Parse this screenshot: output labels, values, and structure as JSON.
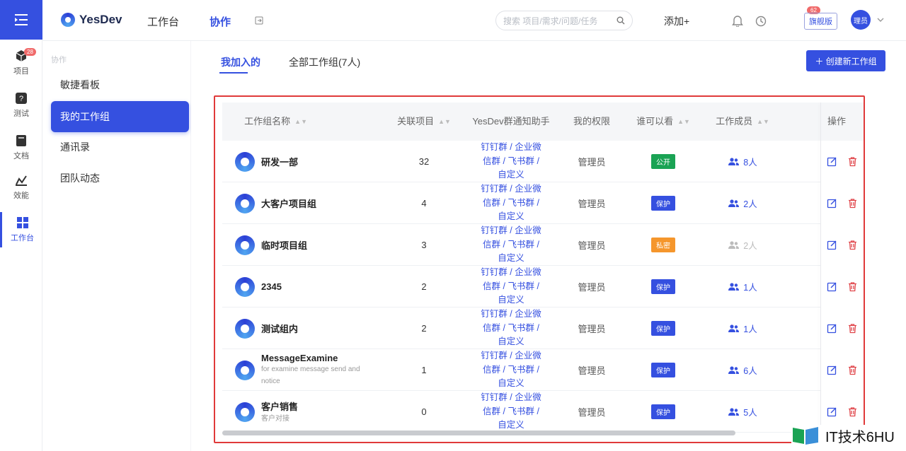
{
  "rail": {
    "items": [
      {
        "label": "项目",
        "badge": "28"
      },
      {
        "label": "测试"
      },
      {
        "label": "文档"
      },
      {
        "label": "效能"
      },
      {
        "label": "工作台"
      }
    ]
  },
  "header": {
    "logo": "YesDev",
    "nav": [
      "工作台",
      "协作"
    ],
    "search_placeholder": "搜索 项目/需求/问题/任务",
    "add_label": "添加+",
    "alarm_badge": "62",
    "edition": "旗舰版",
    "avatar": "理员"
  },
  "sidebar": {
    "section": "协作",
    "items": [
      "敏捷看板",
      "我的工作组",
      "通讯录",
      "团队动态"
    ]
  },
  "tabs": [
    "我加入的",
    "全部工作组(7人)"
  ],
  "create_button": "＋ 创建新工作组",
  "table": {
    "columns": [
      "工作组名称",
      "关联项目",
      "YesDev群通知助手",
      "我的权限",
      "谁可以看",
      "工作成员",
      "操作"
    ],
    "link_lines": [
      "钉钉群 / 企业微",
      "信群 / 飞书群 /",
      "自定义"
    ],
    "rows": [
      {
        "name": "研发一部",
        "desc": "",
        "projects": "32",
        "perm": "管理员",
        "vis": "公开",
        "vis_color": "#1aa354",
        "members": "8人"
      },
      {
        "name": "大客户项目组",
        "desc": "",
        "projects": "4",
        "perm": "管理员",
        "vis": "保护",
        "vis_color": "#3550e0",
        "members": "2人"
      },
      {
        "name": "临时项目组",
        "desc": "",
        "projects": "3",
        "perm": "管理员",
        "vis": "私密",
        "vis_color": "#f5962c",
        "members": "2人"
      },
      {
        "name": "2345",
        "desc": "",
        "projects": "2",
        "perm": "管理员",
        "vis": "保护",
        "vis_color": "#3550e0",
        "members": "1人"
      },
      {
        "name": "测试组内",
        "desc": "",
        "projects": "2",
        "perm": "管理员",
        "vis": "保护",
        "vis_color": "#3550e0",
        "members": "1人"
      },
      {
        "name": "MessageExamine",
        "desc": "for examine message send and notice",
        "projects": "1",
        "perm": "管理员",
        "vis": "保护",
        "vis_color": "#3550e0",
        "members": "6人"
      },
      {
        "name": "客户销售",
        "desc": "客户对接",
        "projects": "0",
        "perm": "管理员",
        "vis": "保护",
        "vis_color": "#3550e0",
        "members": "5人"
      }
    ]
  },
  "watermark": "IT技术6HU"
}
